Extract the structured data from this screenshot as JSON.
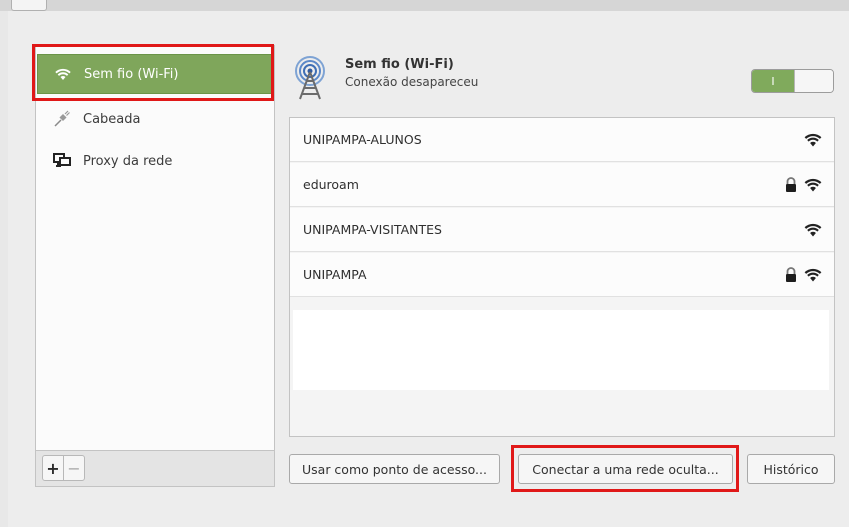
{
  "sidebar": {
    "items": [
      {
        "label": "Sem fio (Wi-Fi)",
        "icon": "wifi-icon",
        "active": true
      },
      {
        "label": "Cabeada",
        "icon": "ethernet-cable-icon"
      },
      {
        "label": "Proxy da rede",
        "icon": "network-proxy-icon"
      }
    ],
    "add_label": "+",
    "remove_label": "−"
  },
  "header": {
    "title": "Sem fio (Wi-Fi)",
    "status": "Conexão desapareceu",
    "icon": "wireless-tower-icon",
    "toggle_label": "I",
    "toggle_on": true
  },
  "networks": [
    {
      "name": "UNIPAMPA-ALUNOS",
      "secured": false
    },
    {
      "name": "eduroam",
      "secured": true
    },
    {
      "name": "UNIPAMPA-VISITANTES",
      "secured": false
    },
    {
      "name": "UNIPAMPA",
      "secured": true
    }
  ],
  "buttons": {
    "hotspot": "Usar como ponto de acesso...",
    "hidden_network": "Conectar a uma rede oculta...",
    "history": "Histórico"
  },
  "colors": {
    "accent_green": "#7fa65b",
    "highlight_red": "#e01818"
  }
}
